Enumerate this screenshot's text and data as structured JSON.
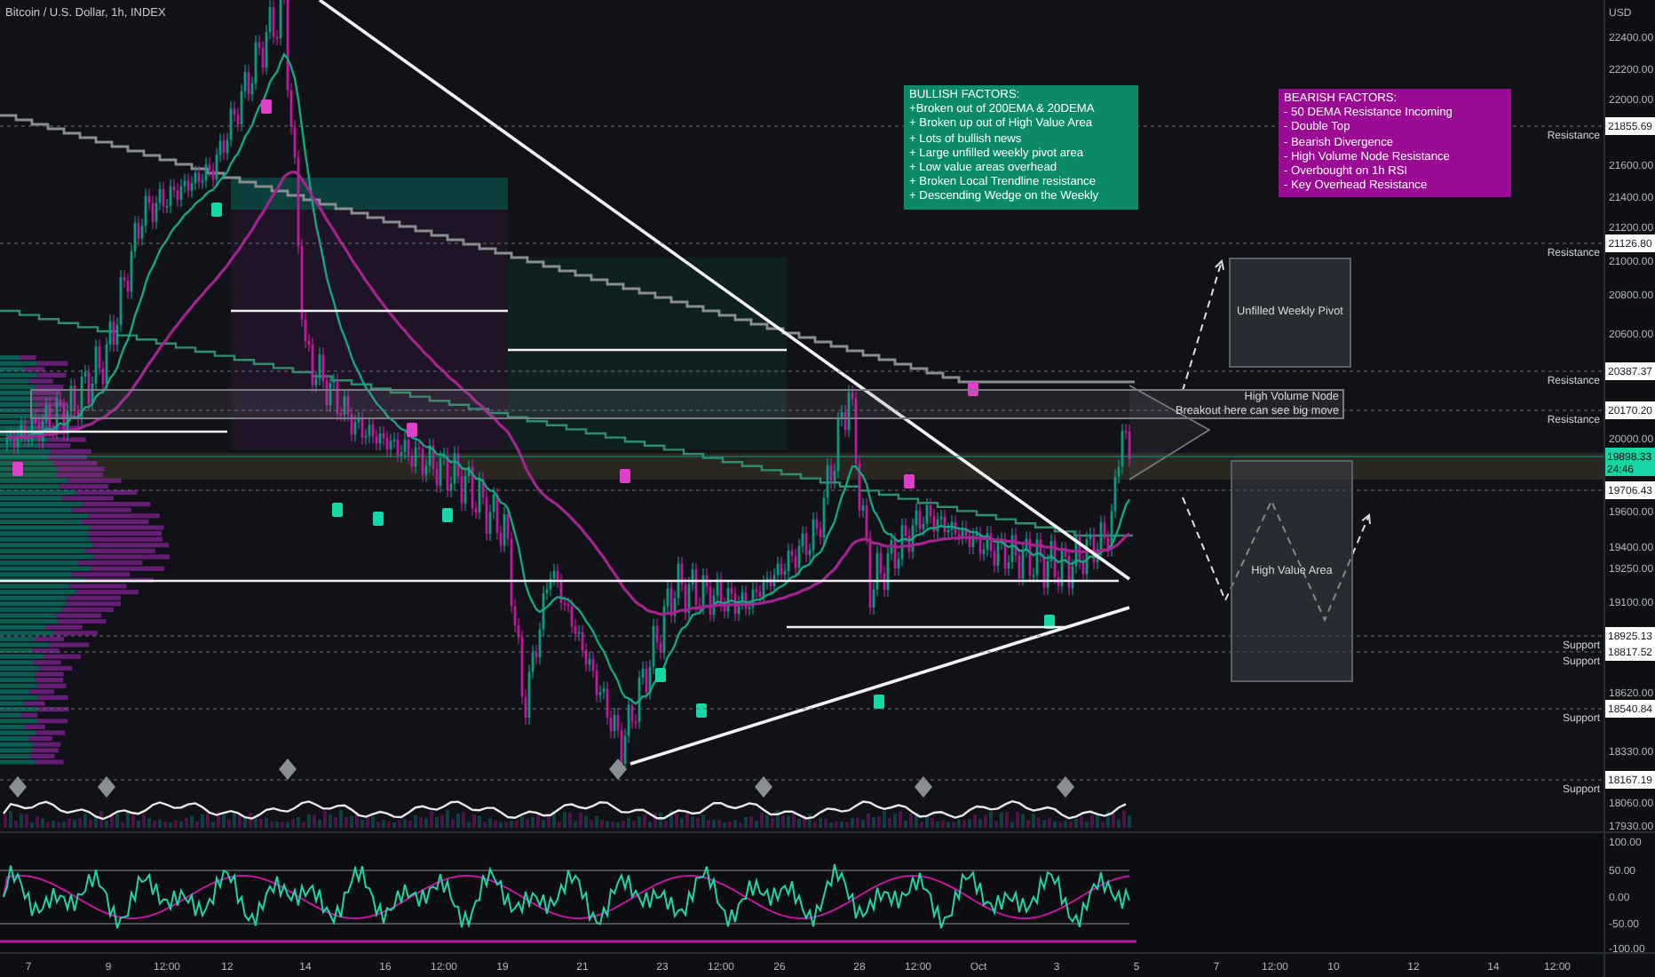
{
  "chart": {
    "title": "Bitcoin / U.S. Dollar, 1h, INDEX"
  },
  "price_axis": {
    "currency": "USD",
    "ticks": [
      "22400.00",
      "22200.00",
      "22000.00",
      "21600.00",
      "21400.00",
      "21200.00",
      "21000.00",
      "20800.00",
      "20600.00",
      "20000.00",
      "19600.00",
      "19400.00",
      "19250.00",
      "19100.00",
      "18620.00",
      "18330.00",
      "18060.00",
      "17930.00"
    ]
  },
  "levels": [
    {
      "price": "21855.69",
      "label": "Resistance"
    },
    {
      "price": "21126.80",
      "label": "Resistance"
    },
    {
      "price": "20387.37",
      "label": "Resistance"
    },
    {
      "price": "20170.20",
      "label": "Resistance"
    },
    {
      "price": "19706.43"
    },
    {
      "price": "18925.13",
      "label": "Support"
    },
    {
      "price": "18817.52",
      "label": "Support"
    },
    {
      "price": "18540.84",
      "label": "Support"
    },
    {
      "price": "18167.19",
      "label": "Support"
    }
  ],
  "last_price": {
    "price": "19898.33",
    "countdown": "24:46"
  },
  "rsi_axis": {
    "ticks": [
      "100.00",
      "50.00",
      "0.00",
      "-50.00",
      "-100.00"
    ]
  },
  "time_axis": {
    "ticks": [
      "7",
      "9",
      "12:00",
      "12",
      "14",
      "16",
      "12:00",
      "19",
      "21",
      "23",
      "12:00",
      "26",
      "28",
      "12:00",
      "Oct",
      "3",
      "5",
      "7",
      "12:00",
      "10",
      "12",
      "14",
      "12:00"
    ]
  },
  "notes": [
    {
      "title": "BULLISH FACTORS:",
      "color": "#0a8a68",
      "lines": [
        "+Broken out of 200EMA & 20DEMA",
        "+ Broken up out of High Value Area",
        "+ Lots of bullish news",
        "+ Large unfilled weekly pivot area",
        "+ Low value areas overhead",
        "+ Broken Local Trendline resistance",
        "+ Descending Wedge on the Weekly"
      ]
    },
    {
      "title": "BEARISH FACTORS:",
      "color": "#9b0a92",
      "lines": [
        "- 50 DEMA Resistance Incoming",
        "- Double Top",
        "- Bearish Divergence",
        "- High Volume Node Resistance",
        "- Overbought on 1h RSI",
        "- Key Overhead Resistance"
      ]
    }
  ],
  "zones": [
    {
      "kind": "box",
      "lines": [
        "Unfilled Weekly Pivot"
      ]
    },
    {
      "kind": "band",
      "lines": [
        "High Volume Node",
        "Breakout here can see big move"
      ]
    },
    {
      "kind": "box",
      "lines": [
        "High Value Area"
      ]
    }
  ]
}
